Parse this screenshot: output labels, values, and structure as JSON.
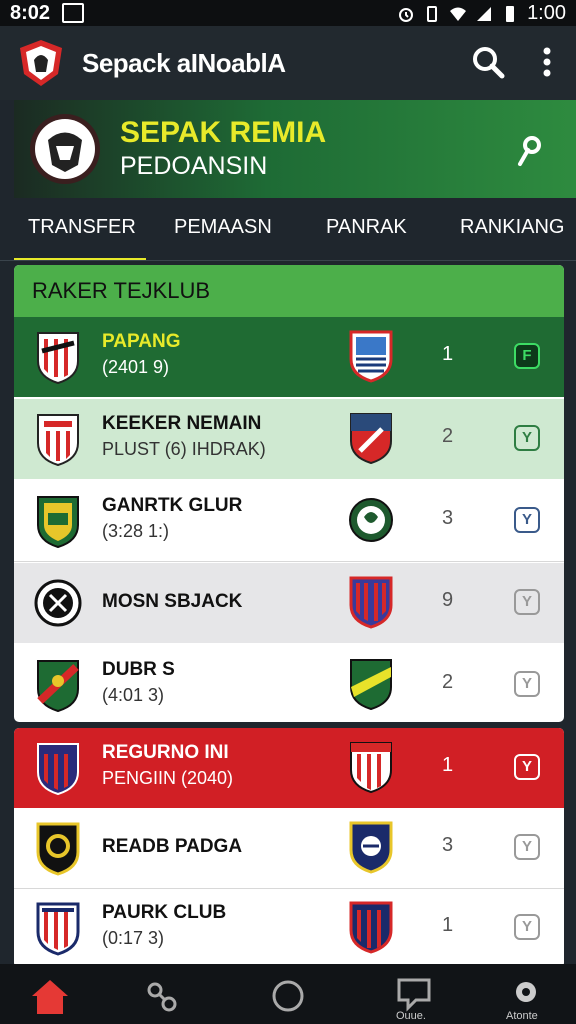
{
  "status_bar": {
    "time": "8:02",
    "clock_right": "1:00"
  },
  "app": {
    "title": "Sepack aINoablA"
  },
  "banner": {
    "title": "SEPAK REMIA",
    "subtitle": "PEDOANSIN"
  },
  "tabs": [
    {
      "label": "TRANSFER",
      "active": true
    },
    {
      "label": "PEMAASN",
      "active": false
    },
    {
      "label": "PANRAK",
      "active": false
    },
    {
      "label": "RANKIANG",
      "active": false
    }
  ],
  "section": {
    "header": "RAKER TEJKLUB"
  },
  "rows": [
    {
      "name": "PAPANG",
      "sub": "(2401 9)",
      "rank": "1",
      "action_glyph": "F"
    },
    {
      "name": "KEEKER NEMAIN",
      "sub": "PLUST (6) IHDRAK)",
      "rank": "2",
      "action_glyph": "Y"
    },
    {
      "name": "GANRTK GLUR",
      "sub": "(3:28 1:)",
      "rank": "3",
      "action_glyph": "Y"
    },
    {
      "name": "MOSN SBJACK",
      "sub": "",
      "rank": "9",
      "action_glyph": "Y"
    },
    {
      "name": "DUBR S",
      "sub": "(4:01 3)",
      "rank": "2",
      "action_glyph": "Y"
    },
    {
      "name": "REGURNO INI",
      "sub": "PENGIIN (2040)",
      "rank": "1",
      "action_glyph": "Y"
    },
    {
      "name": "READB PADGA",
      "sub": "",
      "rank": "3",
      "action_glyph": "Y"
    },
    {
      "name": "PAURK CLUB",
      "sub": "(0:17 3)",
      "rank": "1",
      "action_glyph": "Y"
    }
  ],
  "bottom_nav": {
    "messages_label": "Ouue.",
    "profile_label": "Atonte"
  },
  "colors": {
    "accent_green": "#1f6b33",
    "header_green": "#4caf4a",
    "highlight_yellow": "#e8ea2a",
    "red_row": "#d11f25",
    "nav_home_red": "#e53935"
  }
}
